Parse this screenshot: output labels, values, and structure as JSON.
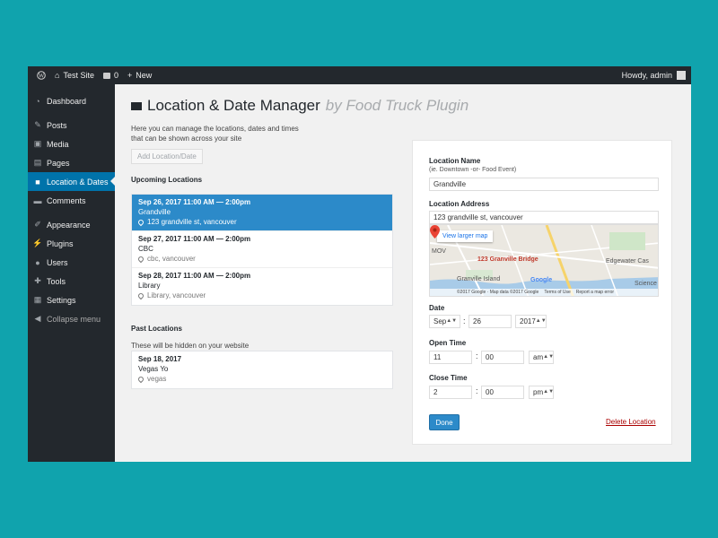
{
  "adminbar": {
    "site_name": "Test Site",
    "comments_count": "0",
    "new_label": "New",
    "howdy": "Howdy, admin"
  },
  "sidebar": {
    "items": [
      {
        "label": "Dashboard",
        "icon": "dashboard-icon"
      },
      {
        "label": "Posts",
        "icon": "pin-icon"
      },
      {
        "label": "Media",
        "icon": "media-icon"
      },
      {
        "label": "Pages",
        "icon": "pages-icon"
      },
      {
        "label": "Location & Dates",
        "icon": "truck-icon",
        "active": true
      },
      {
        "label": "Comments",
        "icon": "comment-icon"
      },
      {
        "label": "Appearance",
        "icon": "brush-icon"
      },
      {
        "label": "Plugins",
        "icon": "plugin-icon"
      },
      {
        "label": "Users",
        "icon": "users-icon"
      },
      {
        "label": "Tools",
        "icon": "wrench-icon"
      },
      {
        "label": "Settings",
        "icon": "settings-icon"
      },
      {
        "label": "Collapse menu",
        "icon": "collapse-icon"
      }
    ]
  },
  "page": {
    "title": "Location & Date Manager",
    "byline": "by Food Truck Plugin",
    "intro": "Here you can manage the locations, dates and times that can be shown across your site",
    "add_button": "Add Location/Date",
    "upcoming_title": "Upcoming Locations",
    "upcoming": [
      {
        "date": "Sep 26, 2017 11:00 AM — 2:00pm",
        "name": "Grandville",
        "address": "123 grandville st, vancouver",
        "selected": true
      },
      {
        "date": "Sep 27, 2017 11:00 AM — 2:00pm",
        "name": "CBC",
        "address": "cbc, vancouver"
      },
      {
        "date": "Sep 28, 2017 11:00 AM — 2:00pm",
        "name": "Library",
        "address": "Library, vancouver"
      }
    ],
    "past_title": "Past Locations",
    "past_note": "These will be hidden on your website",
    "past": [
      {
        "date": "Sep 18, 2017",
        "name": "Vegas Yo",
        "address": "vegas"
      }
    ]
  },
  "form": {
    "location_name_label": "Location Name",
    "location_name_hint": "(ie. Downtown -or- Food Event)",
    "location_name_value": "Grandville",
    "location_address_label": "Location Address",
    "location_address_value": "123 grandville st, vancouver",
    "map": {
      "view_larger": "View larger map",
      "bridge_label": "123 Granville Bridge",
      "edgewater": "Edgewater Cas",
      "granville_island": "Granville Island",
      "science": "Science",
      "mov": "MOV",
      "google": "Google",
      "footer_copyright": "©2017 Google · Map data ©2017 Google",
      "footer_terms": "Terms of Use",
      "footer_report": "Report a map error"
    },
    "date_label": "Date",
    "date_month": "Sep",
    "date_day": "26",
    "date_year": "2017",
    "open_label": "Open Time",
    "open_hour": "11",
    "open_min": "00",
    "open_ampm": "am",
    "close_label": "Close Time",
    "close_hour": "2",
    "close_min": "00",
    "close_ampm": "pm",
    "done": "Done",
    "delete": "Delete Location"
  },
  "colors": {
    "accent": "#0073aa",
    "selected_row": "#2c8ac9",
    "frame": "#10a3ad"
  }
}
